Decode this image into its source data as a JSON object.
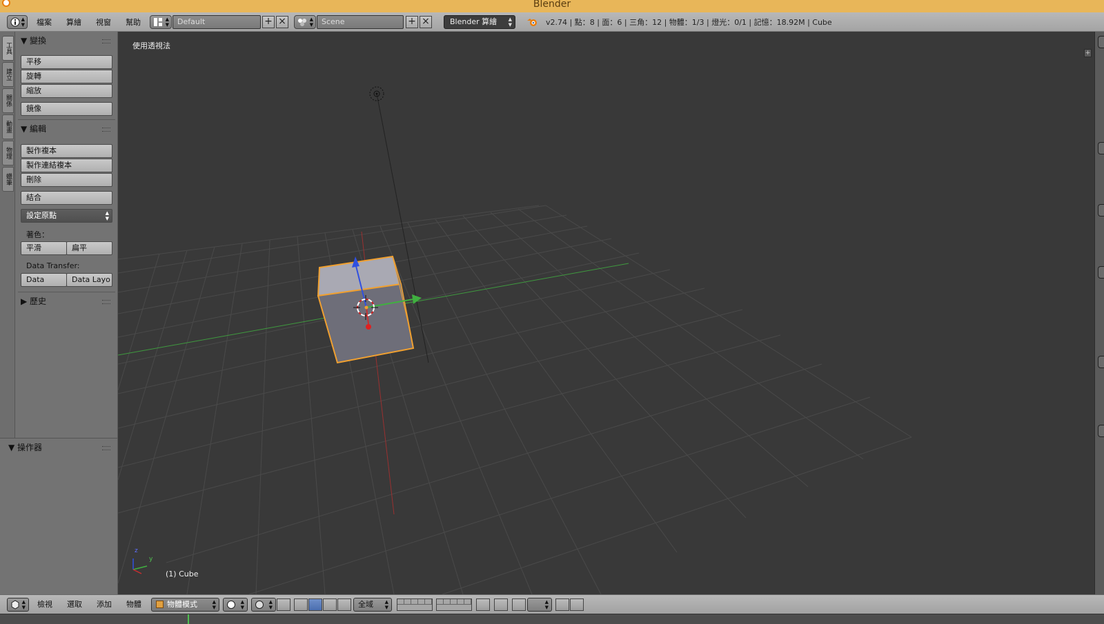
{
  "window": {
    "title": "Blender"
  },
  "header": {
    "menus": [
      "檔案",
      "算繪",
      "視窗",
      "幫助"
    ],
    "screen_layout": "Default",
    "scene": "Scene",
    "render_engine": "Blender 算繪",
    "stats": "v2.74 | 點：8 | 面：6 | 三角：12 | 物體：1/3 | 燈光：0/1 | 記憶：18.92M | Cube"
  },
  "side_tabs": [
    "工具",
    "建立",
    "關係",
    "動畫",
    "物理",
    "蠟筆"
  ],
  "toolshelf": {
    "transform": {
      "title": "▼ 變換",
      "buttons": [
        "平移",
        "旋轉",
        "縮放",
        "鏡像"
      ]
    },
    "edit": {
      "title": "▼ 編輯",
      "buttons": [
        "製作複本",
        "製作連結複本",
        "刪除",
        "結合"
      ],
      "set_origin": "設定原點",
      "shading_label": "著色：",
      "shading_buttons": [
        "平滑",
        "扁平"
      ],
      "data_transfer_label": "Data Transfer:",
      "data_transfer_buttons": [
        "Data",
        "Data Layo"
      ]
    },
    "history": {
      "title": "▶ 歷史"
    }
  },
  "operator_panel": {
    "title": "▼ 操作器"
  },
  "viewport": {
    "view_label": "使用透視法",
    "object_label": "(1) Cube",
    "axis_labels": {
      "z": "z",
      "y": "y"
    }
  },
  "bottom_bar": {
    "menus": [
      "檢視",
      "選取",
      "添加",
      "物體"
    ],
    "mode": "物體模式",
    "orientation": "全域"
  },
  "colors": {
    "title_bar": "#e8b659",
    "viewport_bg": "#393939",
    "selection_outline": "#f0a030",
    "x_axis": "#c83030",
    "y_axis": "#40b040",
    "z_axis": "#3050e0"
  }
}
